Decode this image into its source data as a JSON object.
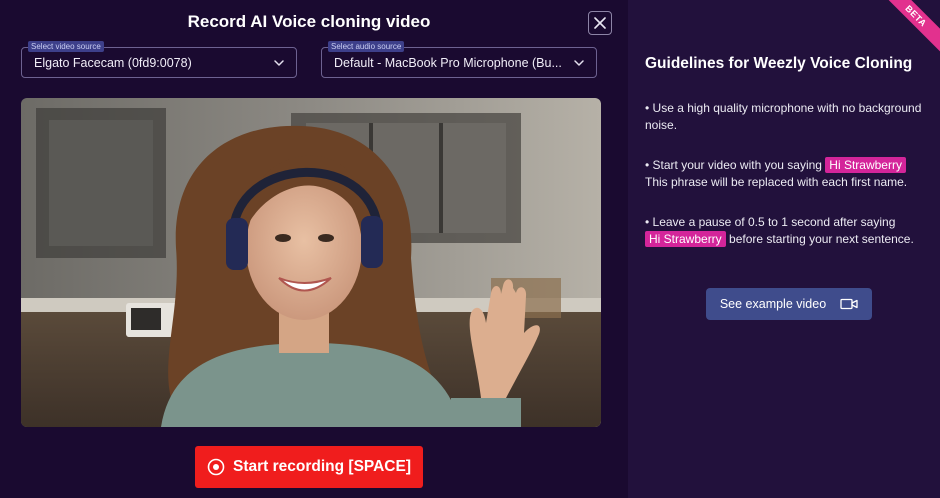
{
  "dialog": {
    "title": "Record AI Voice cloning video",
    "close_icon": "close-icon"
  },
  "video_source": {
    "label": "Select video source",
    "value": "Elgato Facecam (0fd9:0078)"
  },
  "audio_source": {
    "label": "Select audio source",
    "value": "Default - MacBook Pro Microphone (Bu..."
  },
  "record_button": {
    "label": "Start recording [SPACE]",
    "icon": "record-icon"
  },
  "guidelines": {
    "badge": "BETA",
    "title": "Guidelines for Weezly Voice Cloning",
    "item1": "• Use a high quality microphone with no background noise.",
    "item2_prefix": "• Start your video with you saying",
    "item2_highlight": "Hi Strawberry",
    "item2_suffix": "This phrase will be replaced with each first name.",
    "item3_prefix": "• Leave a pause of 0.5 to 1 second after saying",
    "item3_highlight": "Hi Strawberry",
    "item3_suffix": "before starting your next sentence.",
    "example_button": "See example video",
    "example_icon": "video-camera-icon"
  },
  "colors": {
    "background": "#1a0a30",
    "panel": "#22113c",
    "record": "#f01d1d",
    "highlight": "#d4259a",
    "example_button": "#3f4c8c"
  }
}
